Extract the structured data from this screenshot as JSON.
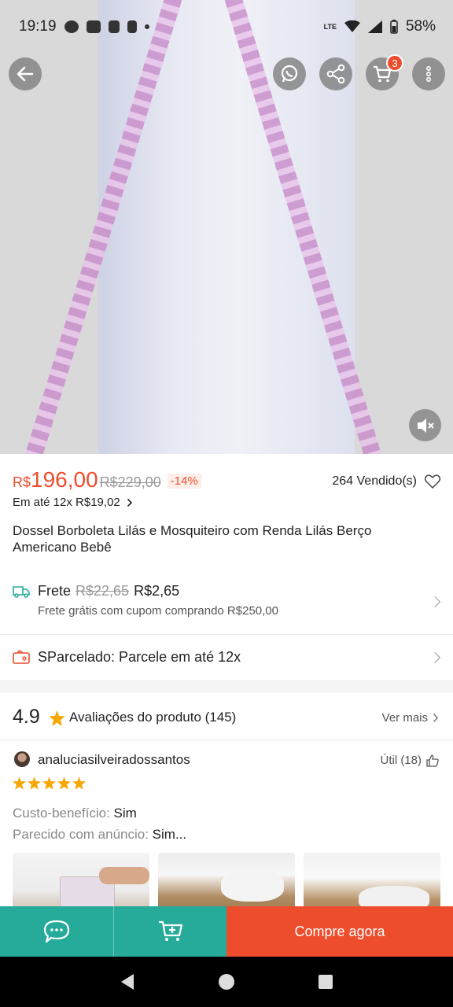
{
  "status_bar": {
    "time": "19:19",
    "network": "LTE",
    "battery": "58%"
  },
  "header": {
    "cart_count": "3"
  },
  "product": {
    "currency": "R$",
    "price": "196,00",
    "old_price": "R$229,00",
    "discount": "-14%",
    "sold": "264 Vendido(s)",
    "installments": "Em até 12x R$19,02",
    "title": "Dossel Borboleta Lilás e Mosquiteiro com Renda Lilás Berço Americano Bebê"
  },
  "shipping": {
    "label": "Frete",
    "old_price": "R$22,65",
    "price": "R$2,65",
    "note": "Frete grátis com cupom comprando R$250,00"
  },
  "sparcelado": {
    "label": "SParcelado: Parcele em até 12x"
  },
  "ratings": {
    "score": "4.9",
    "label": "Avaliações do produto (145)",
    "see_more": "Ver mais"
  },
  "review": {
    "username": "analuciasilveiradossantos",
    "helpful": "Útil (18)",
    "stars": 5,
    "line1_label": "Custo-benefício:",
    "line1_value": "Sim",
    "line2_label": "Parecido com anúncio:",
    "line2_value": "Sim..."
  },
  "actions": {
    "buy_now": "Compre agora"
  },
  "colors": {
    "accent": "#ee4d2d",
    "teal": "#26aa99",
    "star": "#f6a700"
  }
}
